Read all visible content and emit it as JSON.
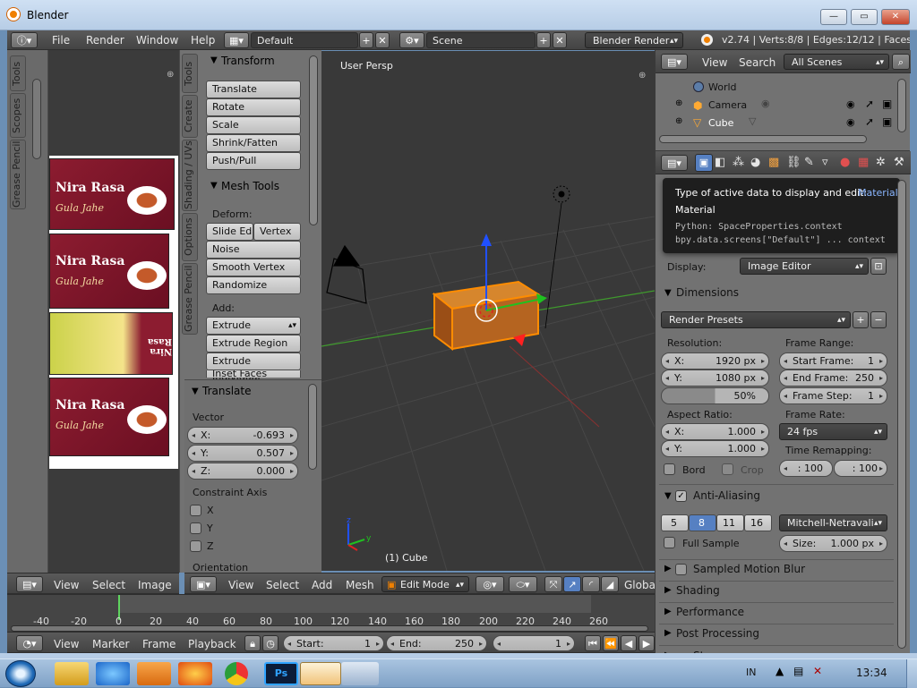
{
  "window": {
    "title": "Blender",
    "min": "—",
    "max": "▭",
    "close": "✕"
  },
  "info_bar": {
    "menus": [
      "File",
      "Render",
      "Window",
      "Help"
    ],
    "layout": "Default",
    "scene": "Scene",
    "engine": "Blender Render",
    "stats": "v2.74 | Verts:8/8 | Edges:12/12 | Faces:6/"
  },
  "image_editor": {
    "tabs": [
      "Tools",
      "Scopes",
      "Grease Pencil"
    ],
    "label_text": "Nira Rasa",
    "sub_text": "Gula Jahe",
    "header_menus": [
      "View",
      "Select",
      "Image"
    ]
  },
  "tool_shelf": {
    "side_tabs": [
      "Tools",
      "Create",
      "Shading / UVs",
      "Options",
      "Grease Pencil"
    ],
    "transform_title": "Transform",
    "transform_buttons": [
      "Translate",
      "Rotate",
      "Scale",
      "Shrink/Fatten",
      "Push/Pull"
    ],
    "mesh_tools_title": "Mesh Tools",
    "deform_label": "Deform:",
    "slide_edge": "Slide Ed",
    "vertex": "Vertex",
    "noise": "Noise",
    "smooth_vertex": "Smooth Vertex",
    "randomize": "Randomize",
    "add_label": "Add:",
    "extrude": "Extrude",
    "extrude_region": "Extrude Region",
    "extrude_individual": "Extrude Individual",
    "inset_faces": "Inset Faces"
  },
  "operator_panel": {
    "title": "Translate",
    "vector_label": "Vector",
    "x_label": "X:",
    "x_value": "-0.693",
    "y_label": "Y:",
    "y_value": "0.507",
    "z_label": "Z:",
    "z_value": "0.000",
    "constraint_label": "Constraint Axis",
    "axes": [
      "X",
      "Y",
      "Z"
    ],
    "orientation_label": "Orientation"
  },
  "viewport": {
    "persp_label": "User Persp",
    "object_label": "(1) Cube",
    "header_menus": [
      "View",
      "Select",
      "Add",
      "Mesh"
    ],
    "mode": "Edit Mode",
    "orientation": "Global"
  },
  "outliner": {
    "menus": [
      "View",
      "Search"
    ],
    "filter": "All Scenes",
    "items": [
      "World",
      "Camera",
      "Cube"
    ]
  },
  "properties": {
    "tooltip_title": "Type of active data to display and edit:",
    "tooltip_value": "Material",
    "tooltip_line2": "Material",
    "tooltip_py1": "Python: SpaceProperties.context",
    "tooltip_py2": "bpy.data.screens[\"Default\"] ... context",
    "display_label": "Display:",
    "display_value": "Image Editor",
    "dimensions_title": "Dimensions",
    "render_presets": "Render Presets",
    "resolution_label": "Resolution:",
    "res_x_label": "X:",
    "res_x": "1920 px",
    "res_y_label": "Y:",
    "res_y": "1080 px",
    "res_pct": "50%",
    "frame_range_label": "Frame Range:",
    "start_frame_label": "Start Frame:",
    "start_frame": "1",
    "end_frame_label": "End Frame:",
    "end_frame": "250",
    "frame_step_label": "Frame Step:",
    "frame_step": "1",
    "aspect_label": "Aspect Ratio:",
    "asp_x_label": "X:",
    "asp_x": "1.000",
    "asp_y_label": "Y:",
    "asp_y": "1.000",
    "frame_rate_label": "Frame Rate:",
    "fps": "24 fps",
    "time_remap_label": "Time Remapping:",
    "remap_old": ": 100",
    "remap_new": ": 100",
    "border": "Bord",
    "crop": "Crop",
    "aa_title": "Anti-Aliasing",
    "aa_samples": [
      "5",
      "8",
      "11",
      "16"
    ],
    "aa_filter": "Mitchell-Netravali",
    "full_sample": "Full Sample",
    "size_label": "Size:",
    "size_value": "1.000 px",
    "collapsed": [
      "Sampled Motion Blur",
      "Shading",
      "Performance",
      "Post Processing",
      "Stamp"
    ]
  },
  "timeline": {
    "ticks": [
      "-40",
      "-20",
      "0",
      "20",
      "40",
      "60",
      "80",
      "100",
      "120",
      "140",
      "160",
      "180",
      "200",
      "220",
      "240",
      "260"
    ],
    "menus": [
      "View",
      "Marker",
      "Frame",
      "Playback"
    ],
    "start_label": "Start:",
    "start": "1",
    "end_label": "End:",
    "end": "250",
    "current": "1"
  },
  "taskbar": {
    "lang": "IN",
    "time": "13:34"
  },
  "colors": {
    "accent_orange": "#f08000",
    "blue_selected": "#5680c2"
  }
}
